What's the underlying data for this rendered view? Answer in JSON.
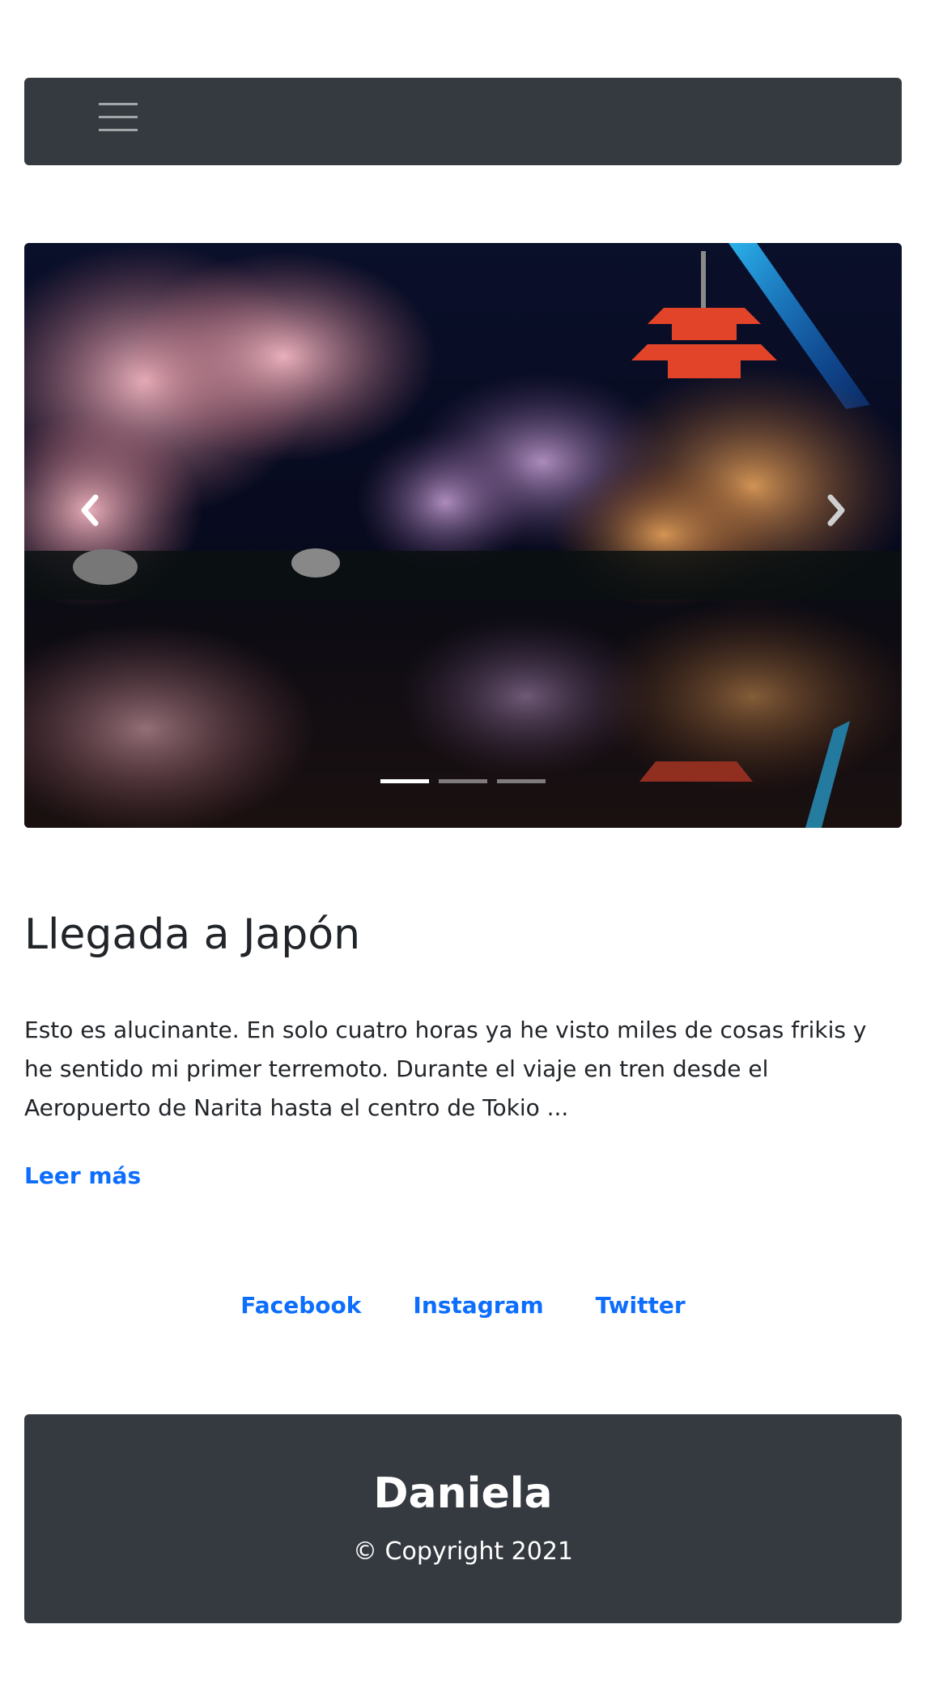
{
  "navbar": {
    "toggler_icon": "hamburger-menu-icon"
  },
  "carousel": {
    "slide_description": "Night view of a Japanese garden with cherry blossom trees, a red pagoda and a blue light beam reflected in a pond",
    "prev_icon": "chevron-left-icon",
    "next_icon": "chevron-right-icon",
    "active_slide": 1,
    "slide_count": 3
  },
  "post": {
    "title": "Llegada a Japón",
    "body": "Esto es alucinante. En solo cuatro horas ya he visto miles de cosas frikis y he sentido mi primer terremoto. Durante el viaje en tren desde el Aeropuerto de Narita hasta el centro de Tokio ...",
    "read_more": "Leer más"
  },
  "social": {
    "links": [
      "Facebook",
      "Instagram",
      "Twitter"
    ]
  },
  "footer": {
    "name": "Daniela",
    "copyright": "© Copyright 2021"
  },
  "colors": {
    "dark": "#343a40",
    "link": "#0d6efd",
    "text": "#212529"
  }
}
